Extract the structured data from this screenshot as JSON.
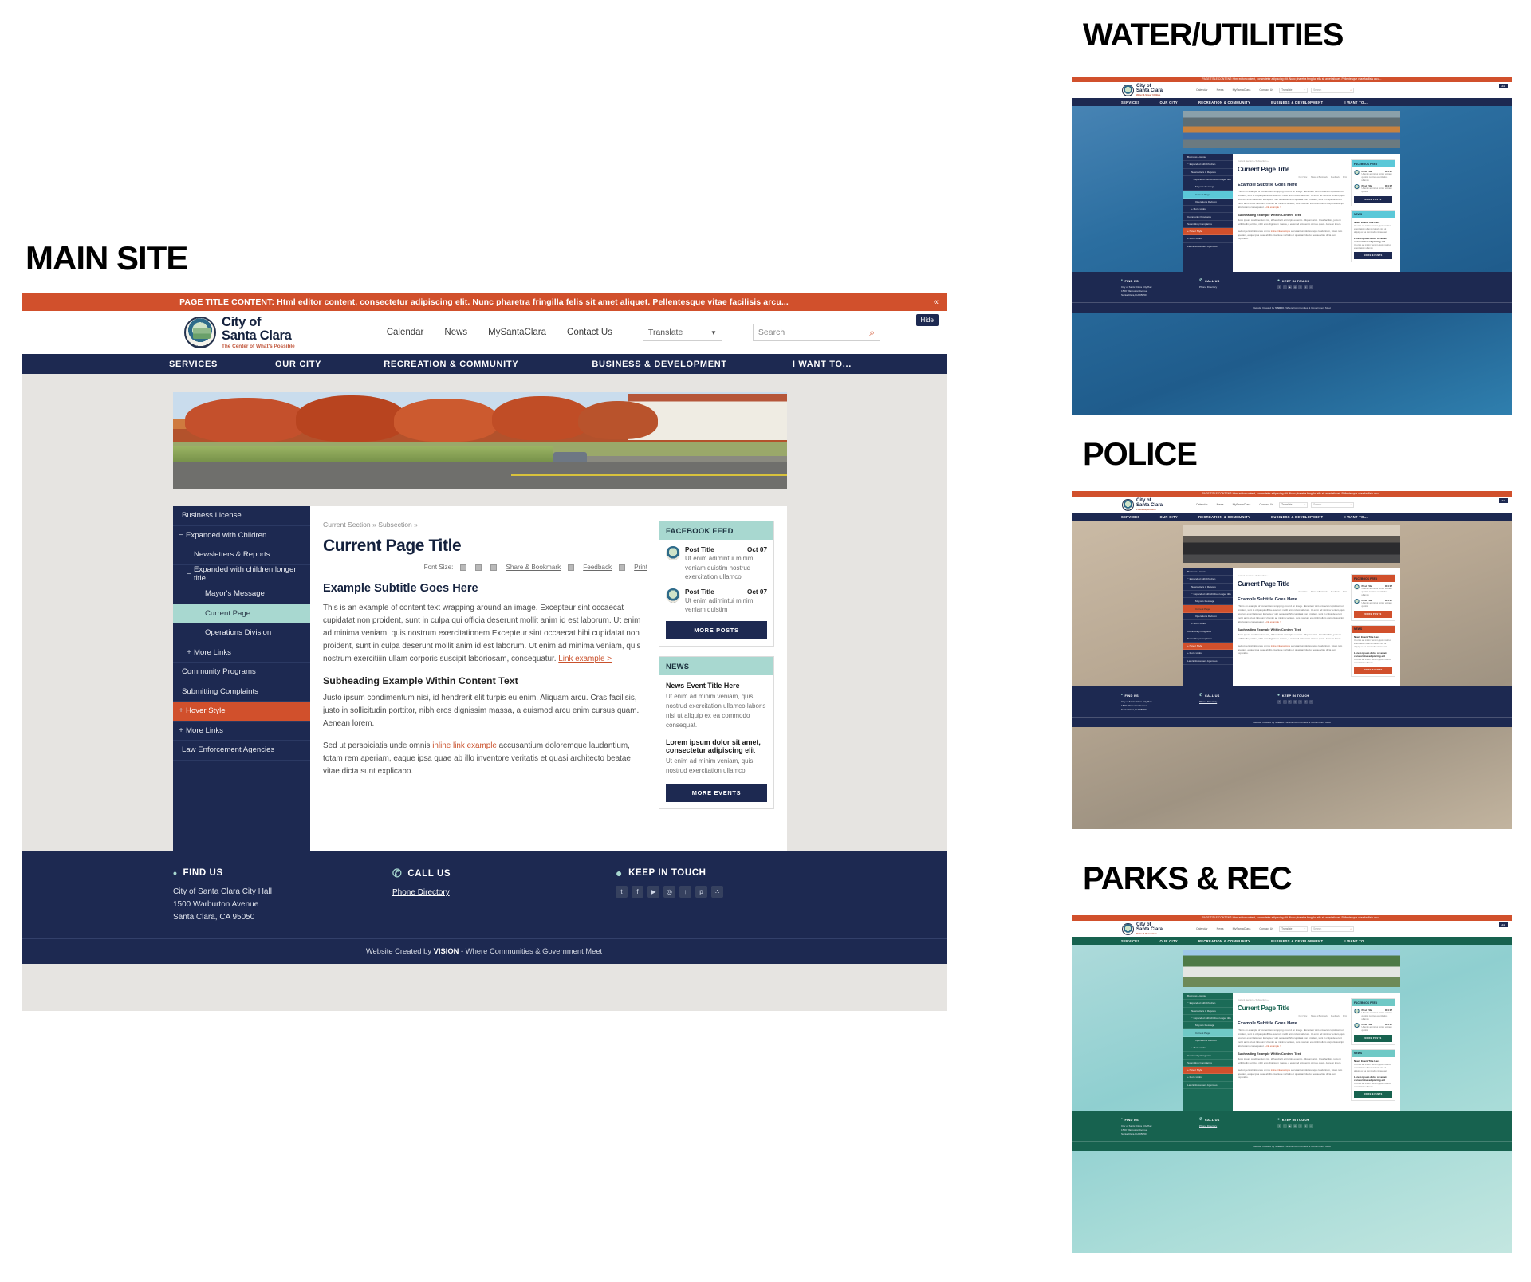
{
  "section_labels": {
    "main": "MAIN SITE",
    "water": "WATER/UTILITIES",
    "police": "POLICE",
    "parks": "PARKS & REC"
  },
  "alert": {
    "text": "PAGE TITLE CONTENT: Html editor content, consectetur adipiscing elit. Nunc pharetra fringilla felis sit amet aliquet. Pellentesque vitae facilisis arcu...",
    "collapse_icon": "«",
    "background": "#d1502c"
  },
  "header": {
    "logo": {
      "line1": "City of",
      "line2": "Santa Clara",
      "tagline": "The Center of What's Possible"
    },
    "nav": [
      "Calendar",
      "News",
      "MySantaClara",
      "Contact Us"
    ],
    "translate": {
      "label": "Translate",
      "caret": "▼"
    },
    "search": {
      "placeholder": "Search",
      "icon": "⌕"
    },
    "hide_label": "Hide"
  },
  "mainnav": {
    "items": [
      "SERVICES",
      "OUR CITY",
      "RECREATION & COMMUNITY",
      "BUSINESS & DEVELOPMENT",
      "I WANT TO..."
    ],
    "background": "#1d2951"
  },
  "sidebar": {
    "items": [
      {
        "label": "Business License",
        "depth": 0,
        "toggle": "",
        "state": "normal"
      },
      {
        "label": "Expanded with Children",
        "depth": 0,
        "toggle": "−",
        "state": "normal"
      },
      {
        "label": "Newsletters & Reports",
        "depth": 1,
        "toggle": "",
        "state": "normal"
      },
      {
        "label": "Expanded with children longer title",
        "depth": 1,
        "toggle": "−",
        "state": "normal"
      },
      {
        "label": "Mayor's Message",
        "depth": 2,
        "toggle": "",
        "state": "normal"
      },
      {
        "label": "Current Page",
        "depth": 2,
        "toggle": "",
        "state": "current"
      },
      {
        "label": "Operations Division",
        "depth": 2,
        "toggle": "",
        "state": "normal"
      },
      {
        "label": "More Links",
        "depth": 1,
        "toggle": "+",
        "state": "normal"
      },
      {
        "label": "Community Programs",
        "depth": 0,
        "toggle": "",
        "state": "normal"
      },
      {
        "label": "Submitting Complaints",
        "depth": 0,
        "toggle": "",
        "state": "normal"
      },
      {
        "label": "Hover Style",
        "depth": 0,
        "toggle": "+",
        "state": "hover"
      },
      {
        "label": "More Links",
        "depth": 0,
        "toggle": "+",
        "state": "normal"
      },
      {
        "label": "Law Enforcement Agencies",
        "depth": 0,
        "toggle": "",
        "state": "normal"
      }
    ],
    "current_background": "#a8d8d0",
    "hover_background": "#d1502c"
  },
  "content": {
    "breadcrumb": "Current Section » Subsection »",
    "page_title": "Current Page Title",
    "tools": {
      "font_size_label": "Font Size:",
      "increase": "+",
      "decrease": "−",
      "share": "Share & Bookmark",
      "feedback": "Feedback",
      "print": "Print"
    },
    "subtitle": "Example Subtitle Goes Here",
    "paragraph1": "This is an example of content text wrapping around an image. Excepteur  sint occaecat cupidatat non proident,  sunt in culpa qui officia deserunt mollit  anim id est laborum.  Ut enim ad minima  veniam, quis nostrum exercitationem Excepteur  sint occaecat hihi cupidatat non proident,  sunt in culpa deserunt mollit  anim id est laborum.  Ut enim ad minima  veniam, quis nostrum exercitiiin ullam corporis suscipit laboriosam, consequatur. ",
    "paragraph1_link": "Link example >",
    "subheading": "Subheading Example Within Content Text",
    "paragraph2": "Justo ipsum condimentum nisi, id hendrerit elit turpis eu enim. Aliquam arcu. Cras facilisis, justo in sollicitudin porttitor, nibh eros dignissim massa, a euismod arcu enim cursus quam. Aenean lorem.",
    "paragraph3_before": "Sed ut perspiciatis unde omnis ",
    "paragraph3_link": "inline link example",
    "paragraph3_after": " accusantium doloremque laudantium, totam rem aperiam, eaque ipsa quae ab illo inventore veritatis et quasi architecto beatae vitae dicta sunt explicabo."
  },
  "facebook_widget": {
    "title": "FACEBOOK FEED",
    "posts": [
      {
        "title": "Post Title",
        "date": "Oct 07",
        "text": "Ut enim adimintui minim veniam quistim nostrud exercitation ullamco"
      },
      {
        "title": "Post Title",
        "date": "Oct 07",
        "text": "Ut enim adimintui minim veniam quistim"
      }
    ],
    "button": "MORE POSTS"
  },
  "news_widget": {
    "title": "NEWS",
    "items": [
      {
        "title": "News Event Title Here",
        "text": "Ut enim ad minim veniam, quis nostrud exercitation ullamco laboris nisi ut aliquip ex ea commodo consequat."
      },
      {
        "title": "Lorem ipsum dolor sit amet, consectetur adipiscing elit",
        "text": "Ut enim ad minim veniam, quis nostrud exercitation ullamco"
      }
    ],
    "button": "MORE EVENTS"
  },
  "footer": {
    "find_us": {
      "heading": "FIND US",
      "icon": "•",
      "line1": "City of Santa Clara City Hall",
      "line2": "1500 Warburton Avenue",
      "line3": "Santa Clara, CA 95050"
    },
    "call_us": {
      "heading": "CALL US",
      "icon": "✆",
      "link": "Phone Directory"
    },
    "keep_in_touch": {
      "heading": "KEEP IN TOUCH",
      "icon": "●",
      "socials": [
        "t",
        "f",
        "▶",
        "◎",
        "↑",
        "p",
        "∴"
      ]
    },
    "credit_before": "Website Created by ",
    "credit_brand": "VISION",
    "credit_after": " - Where Communities & Government Meet"
  },
  "thumbnails": [
    {
      "key": "water",
      "label": "WATER/UTILITIES",
      "dept_tagline": "Water & Sewer Utilities",
      "accent": "#5bc8d8",
      "nav_bg": "#1d2951",
      "sidebar_bg": "#1d2951",
      "current_bg": "#5bc8d8",
      "button_bg": "#1d2951",
      "title_color": "#14213d",
      "page_bg": "#2d6b96",
      "hero_desc": "water-utility-workers-photo"
    },
    {
      "key": "police",
      "label": "POLICE",
      "dept_tagline": "Police Department",
      "accent": "#d1502c",
      "nav_bg": "#1d2951",
      "sidebar_bg": "#1d2951",
      "current_bg": "#d1502c",
      "button_bg": "#d1502c",
      "title_color": "#14213d",
      "page_bg": "#c4b5a4",
      "hero_desc": "police-officers-group-photo"
    },
    {
      "key": "parks",
      "label": "PARKS & REC",
      "dept_tagline": "Parks & Recreation",
      "accent": "#6fc9c6",
      "nav_bg": "#17624f",
      "sidebar_bg": "#1b6b57",
      "current_bg": "#6fc9c6",
      "button_bg": "#17624f",
      "title_color": "#17624f",
      "page_bg": "#9fd4d8",
      "hero_desc": "park-festival-tents-photo"
    }
  ]
}
